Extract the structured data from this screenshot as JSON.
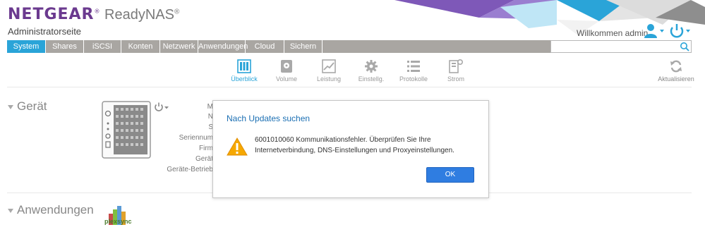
{
  "header": {
    "brand": "NETGEAR",
    "brand_mark": "®",
    "product": "ReadyNAS",
    "product_mark": "®",
    "subtitle": "Administratorseite",
    "welcome": "Willkommen admin",
    "brand_color": "#6b3a8f",
    "accent_color": "#2aa4d8"
  },
  "tabs": [
    {
      "label": "System",
      "active": true
    },
    {
      "label": "Shares"
    },
    {
      "label": "iSCSI"
    },
    {
      "label": "Konten"
    },
    {
      "label": "Netzwerk"
    },
    {
      "label": "Anwendungen"
    },
    {
      "label": "Cloud"
    },
    {
      "label": "Sichern"
    }
  ],
  "search": {
    "placeholder": "",
    "icon": "search-icon"
  },
  "subtabs": [
    {
      "label": "Überblick",
      "icon": "overview-icon",
      "active": true
    },
    {
      "label": "Volume",
      "icon": "volume-icon"
    },
    {
      "label": "Leistung",
      "icon": "performance-icon"
    },
    {
      "label": "Einstellg.",
      "icon": "settings-gear-icon"
    },
    {
      "label": "Protokolle",
      "icon": "logs-icon"
    },
    {
      "label": "Strom",
      "icon": "power-settings-icon"
    }
  ],
  "refresh": {
    "label": "Aktualisieren",
    "icon": "refresh-icon"
  },
  "device_section": {
    "title": "Gerät",
    "labels": [
      "M",
      "N",
      "S",
      "Seriennum",
      "Firm",
      "Gerät",
      "Geräte-Betrieb"
    ]
  },
  "apps_section": {
    "title": "Anwendungen",
    "app_logo_text": "plexsync"
  },
  "dialog": {
    "title": "Nach Updates suchen",
    "message_line1": "6001010060 Kommunikationsfehler. Überprüfen Sie Ihre",
    "message_line2": "Internetverbindung, DNS-Einstellungen und Proxyeinstellungen.",
    "ok_label": "OK",
    "icon": "warning-icon"
  }
}
